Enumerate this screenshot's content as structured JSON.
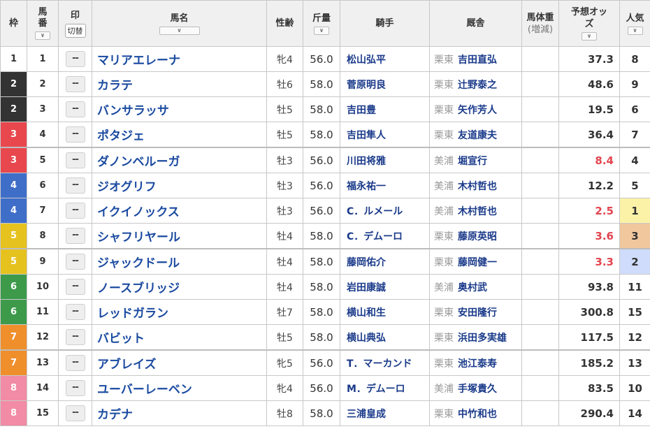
{
  "header": {
    "waku": "枠",
    "umaban": "馬番",
    "mark": "印",
    "mark_switch": "切替",
    "horse_name": "馬名",
    "sex_age": "性齢",
    "kinryo": "斤量",
    "jockey": "騎手",
    "stable": "厩舎",
    "weight": "馬体重",
    "weight_sub": "(増減)",
    "odds": "予想オッズ",
    "ninki": "人気"
  },
  "rows": [
    {
      "waku": "1",
      "umaban": "1",
      "mark": "--",
      "horse": "マリアエレーナ",
      "sex_age": "牝4",
      "kinryo": "56.0",
      "jockey": "松山弘平",
      "area": "栗東",
      "trainer": "吉田直弘",
      "weight": "",
      "odds": "37.3",
      "ninki": "8"
    },
    {
      "waku": "2",
      "umaban": "2",
      "mark": "--",
      "horse": "カラテ",
      "sex_age": "牡6",
      "kinryo": "58.0",
      "jockey": "菅原明良",
      "area": "栗東",
      "trainer": "辻野泰之",
      "weight": "",
      "odds": "48.6",
      "ninki": "9"
    },
    {
      "waku": "2",
      "umaban": "3",
      "mark": "--",
      "horse": "バンサラッサ",
      "sex_age": "牡5",
      "kinryo": "58.0",
      "jockey": "吉田豊",
      "area": "栗東",
      "trainer": "矢作芳人",
      "weight": "",
      "odds": "19.5",
      "ninki": "6"
    },
    {
      "waku": "3",
      "umaban": "4",
      "mark": "--",
      "horse": "ポタジェ",
      "sex_age": "牡5",
      "kinryo": "58.0",
      "jockey": "吉田隼人",
      "area": "栗東",
      "trainer": "友道康夫",
      "weight": "",
      "odds": "36.4",
      "ninki": "7"
    },
    {
      "waku": "3",
      "umaban": "5",
      "mark": "--",
      "horse": "ダノンベルーガ",
      "sex_age": "牡3",
      "kinryo": "56.0",
      "jockey": "川田将雅",
      "area": "美浦",
      "trainer": "堀宣行",
      "weight": "",
      "odds": "8.4",
      "ninki": "4"
    },
    {
      "waku": "4",
      "umaban": "6",
      "mark": "--",
      "horse": "ジオグリフ",
      "sex_age": "牡3",
      "kinryo": "56.0",
      "jockey": "福永祐一",
      "area": "美浦",
      "trainer": "木村哲也",
      "weight": "",
      "odds": "12.2",
      "ninki": "5"
    },
    {
      "waku": "4",
      "umaban": "7",
      "mark": "--",
      "horse": "イクイノックス",
      "sex_age": "牡3",
      "kinryo": "56.0",
      "jockey": "C．ルメール",
      "area": "美浦",
      "trainer": "木村哲也",
      "weight": "",
      "odds": "2.5",
      "ninki": "1"
    },
    {
      "waku": "5",
      "umaban": "8",
      "mark": "--",
      "horse": "シャフリヤール",
      "sex_age": "牡4",
      "kinryo": "58.0",
      "jockey": "C．デムーロ",
      "area": "栗東",
      "trainer": "藤原英昭",
      "weight": "",
      "odds": "3.6",
      "ninki": "3"
    },
    {
      "waku": "5",
      "umaban": "9",
      "mark": "--",
      "horse": "ジャックドール",
      "sex_age": "牡4",
      "kinryo": "58.0",
      "jockey": "藤岡佑介",
      "area": "栗東",
      "trainer": "藤岡健一",
      "weight": "",
      "odds": "3.3",
      "ninki": "2"
    },
    {
      "waku": "6",
      "umaban": "10",
      "mark": "--",
      "horse": "ノースブリッジ",
      "sex_age": "牡4",
      "kinryo": "58.0",
      "jockey": "岩田康誠",
      "area": "美浦",
      "trainer": "奥村武",
      "weight": "",
      "odds": "93.8",
      "ninki": "11"
    },
    {
      "waku": "6",
      "umaban": "11",
      "mark": "--",
      "horse": "レッドガラン",
      "sex_age": "牡7",
      "kinryo": "58.0",
      "jockey": "横山和生",
      "area": "栗東",
      "trainer": "安田隆行",
      "weight": "",
      "odds": "300.8",
      "ninki": "15"
    },
    {
      "waku": "7",
      "umaban": "12",
      "mark": "--",
      "horse": "バビット",
      "sex_age": "牡5",
      "kinryo": "58.0",
      "jockey": "横山典弘",
      "area": "栗東",
      "trainer": "浜田多実雄",
      "weight": "",
      "odds": "117.5",
      "ninki": "12"
    },
    {
      "waku": "7",
      "umaban": "13",
      "mark": "--",
      "horse": "アブレイズ",
      "sex_age": "牝5",
      "kinryo": "56.0",
      "jockey": "T．マーカンド",
      "area": "栗東",
      "trainer": "池江泰寿",
      "weight": "",
      "odds": "185.2",
      "ninki": "13"
    },
    {
      "waku": "8",
      "umaban": "14",
      "mark": "--",
      "horse": "ユーバーレーベン",
      "sex_age": "牝4",
      "kinryo": "56.0",
      "jockey": "M．デムーロ",
      "area": "美浦",
      "trainer": "手塚貴久",
      "weight": "",
      "odds": "83.5",
      "ninki": "10"
    },
    {
      "waku": "8",
      "umaban": "15",
      "mark": "--",
      "horse": "カデナ",
      "sex_age": "牡8",
      "kinryo": "58.0",
      "jockey": "三浦皇成",
      "area": "栗東",
      "trainer": "中竹和也",
      "weight": "",
      "odds": "290.4",
      "ninki": "14"
    }
  ],
  "colors": {
    "waku_1": "#ffffff",
    "waku_2": "#333333",
    "waku_3": "#e8474e",
    "waku_4": "#3f6ec9",
    "waku_5": "#e6c21f",
    "waku_6": "#3c9a4a",
    "waku_7": "#ef8f2c",
    "waku_8": "#f28ba5",
    "horse_name": "#1a4aa0",
    "favorite_odds": "#e2444e",
    "ninki_1": "#fbf2a8",
    "ninki_2": "#cfdcfb",
    "ninki_3": "#f1c79e"
  },
  "icons": {
    "sort": "sort-chevron-down-icon"
  }
}
